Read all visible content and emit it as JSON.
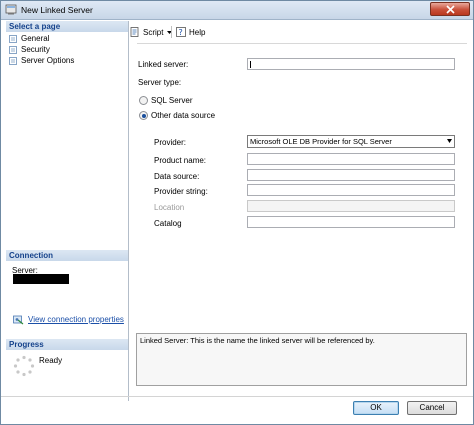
{
  "window": {
    "title": "New Linked Server"
  },
  "left_panel": {
    "select_page_header": "Select a page",
    "pages": [
      {
        "label": "General",
        "icon": "page-icon"
      },
      {
        "label": "Security",
        "icon": "page-icon"
      },
      {
        "label": "Server Options",
        "icon": "page-icon"
      }
    ],
    "connection_header": "Connection",
    "server_label": "Server:",
    "view_connection_link": "View connection properties",
    "progress_header": "Progress",
    "progress_status": "Ready"
  },
  "toolbar": {
    "script_label": "Script",
    "help_label": "Help"
  },
  "form": {
    "linked_server_label": "Linked server:",
    "linked_server_value": "",
    "server_type_label": "Server type:",
    "radio_sql_server": "SQL Server",
    "radio_other_source": "Other data source",
    "selected_server_type": "Other data source",
    "provider_label": "Provider:",
    "provider_value": "Microsoft OLE DB Provider for SQL Server",
    "product_name_label": "Product name:",
    "data_source_label": "Data source:",
    "provider_string_label": "Provider string:",
    "location_label": "Location",
    "catalog_label": "Catalog"
  },
  "description": "Linked Server: This is the name the linked server will be referenced by.",
  "buttons": {
    "ok": "OK",
    "cancel": "Cancel"
  }
}
